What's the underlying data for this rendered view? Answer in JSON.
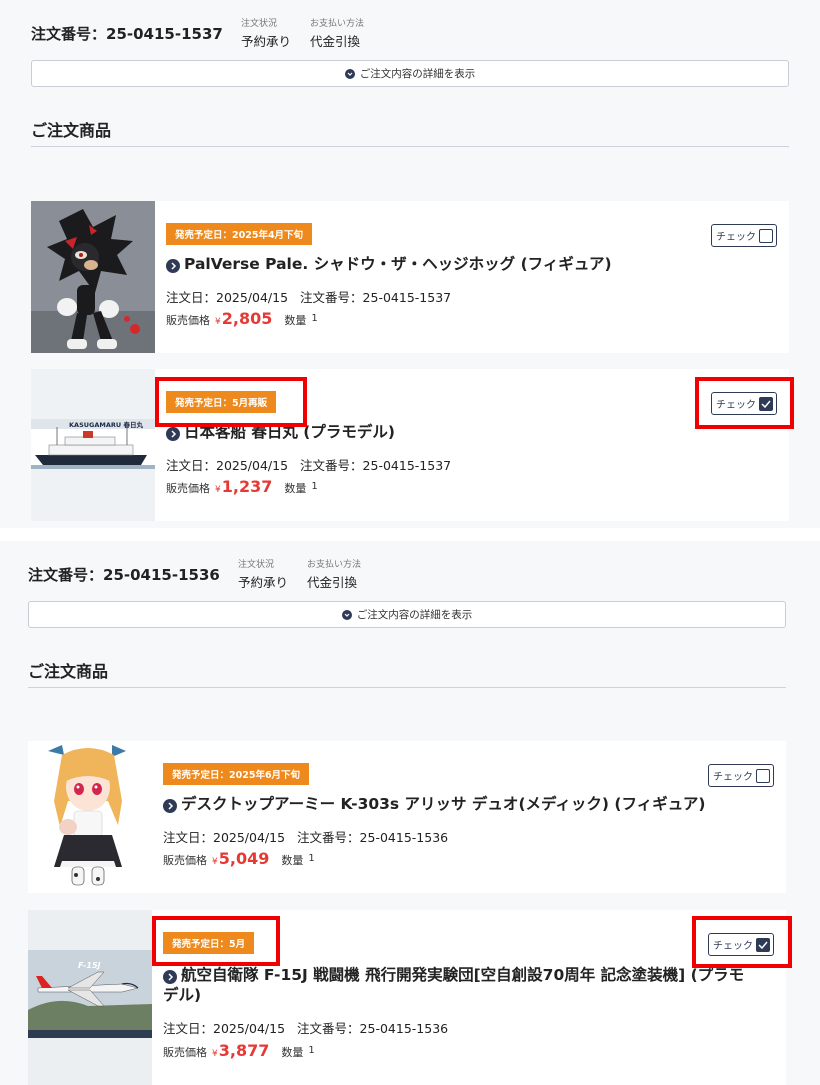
{
  "orders": [
    {
      "order_no_label": "注文番号：25-0415-1537",
      "status_label": "注文状況",
      "status_value": "予約承り",
      "payment_label": "お支払い方法",
      "payment_value": "代金引換",
      "details_button": "ご注文内容の詳細を表示",
      "section_title": "ご注文商品",
      "products": [
        {
          "badge": "発売予定日：2025年4月下旬",
          "title": "PalVerse Pale. シャドウ・ザ・ヘッジホッグ (フィギュア)",
          "order_date": "注文日：2025/04/15",
          "order_no": "注文番号：25-0415-1537",
          "price_label": "販売価格",
          "price_currency": "¥",
          "price": "2,805",
          "qty_label": "数量",
          "qty": "1",
          "check_label": "チェック",
          "checked": false
        },
        {
          "badge": "発売予定日：5月再販",
          "title": "日本客船 春日丸 (プラモデル)",
          "order_date": "注文日：2025/04/15",
          "order_no": "注文番号：25-0415-1537",
          "price_label": "販売価格",
          "price_currency": "¥",
          "price": "1,237",
          "qty_label": "数量",
          "qty": "1",
          "check_label": "チェック",
          "checked": true
        }
      ]
    },
    {
      "order_no_label": "注文番号：25-0415-1536",
      "status_label": "注文状況",
      "status_value": "予約承り",
      "payment_label": "お支払い方法",
      "payment_value": "代金引換",
      "details_button": "ご注文内容の詳細を表示",
      "section_title": "ご注文商品",
      "products": [
        {
          "badge": "発売予定日：2025年6月下旬",
          "title": "デスクトップアーミー K-303s アリッサ デュオ(メディック) (フィギュア)",
          "order_date": "注文日：2025/04/15",
          "order_no": "注文番号：25-0415-1536",
          "price_label": "販売価格",
          "price_currency": "¥",
          "price": "5,049",
          "qty_label": "数量",
          "qty": "1",
          "check_label": "チェック",
          "checked": false
        },
        {
          "badge": "発売予定日：5月",
          "title": "航空自衛隊 F-15J 戦闘機 飛行開発実験団[空自創設70周年 記念塗装機] (プラモデル)",
          "order_date": "注文日：2025/04/15",
          "order_no": "注文番号：25-0415-1536",
          "price_label": "販売価格",
          "price_currency": "¥",
          "price": "3,877",
          "qty_label": "数量",
          "qty": "1",
          "check_label": "チェック",
          "checked": true
        }
      ]
    }
  ],
  "thumb_texts": {
    "ship_box_label": "KASUGAMARU 春日丸",
    "jet_box_label": "F-15J"
  },
  "colors": {
    "badge": "#ee8a1d",
    "price": "#e53935",
    "navy": "#2f3b56",
    "highlight": "#f00000"
  }
}
